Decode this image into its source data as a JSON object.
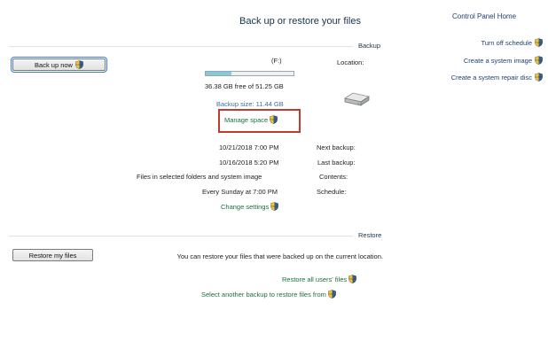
{
  "nav": {
    "home": "Control Panel Home",
    "links": [
      {
        "label": "Turn off schedule",
        "icon": "shield-icon"
      },
      {
        "label": "Create a system image",
        "icon": "shield-icon"
      },
      {
        "label": "Create a system repair disc",
        "icon": "shield-icon"
      }
    ]
  },
  "page": {
    "title": "Back up or restore your files"
  },
  "backup": {
    "section_label": "Backup",
    "back_up_now_button": "Back up now",
    "location_label": "Location:",
    "location_value": "(F:)",
    "space_text": "36.38 GB free of 51.25 GB",
    "space_used_fraction": 0.29,
    "backup_size": "Backup size: 11.44 GB",
    "manage_space_link": "Manage space",
    "next_backup_label": "Next backup:",
    "next_backup_value": "10/21/2018 7:00 PM",
    "last_backup_label": "Last backup:",
    "last_backup_value": "10/16/2018 5:20 PM",
    "contents_label": "Contents:",
    "contents_value": "Files in selected folders and system image",
    "schedule_label": "Schedule:",
    "schedule_value": "Every Sunday at 7:00 PM",
    "change_settings_link": "Change settings"
  },
  "restore": {
    "section_label": "Restore",
    "restore_button": "Restore my files",
    "description": "You can restore your files that were backed up on the current location.",
    "restore_all_users_link": "Restore all users' files",
    "select_another_link": "Select another backup to restore files from"
  },
  "colors": {
    "accent": "#86c9d8",
    "highlight": "#c4392f",
    "link": "#1c6f3e"
  }
}
